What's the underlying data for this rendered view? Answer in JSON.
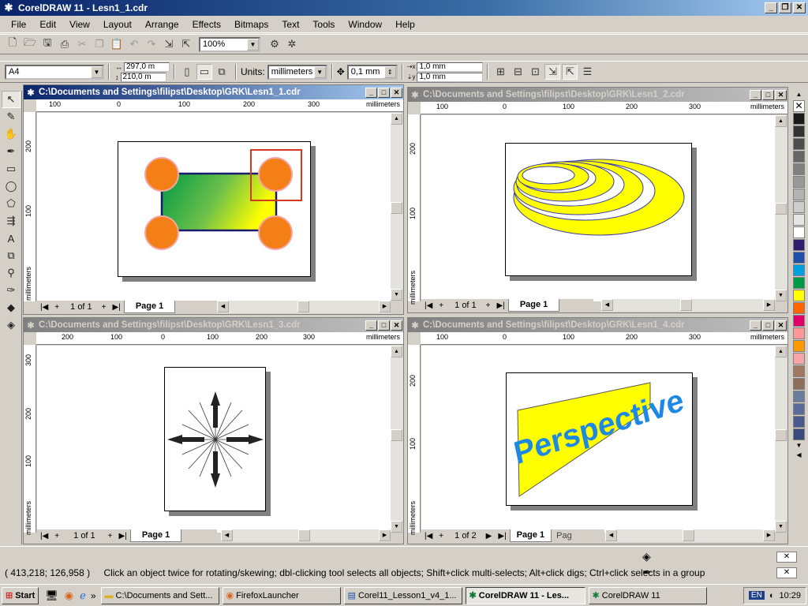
{
  "app": {
    "title": "CorelDRAW 11 - Lesn1_1.cdr"
  },
  "menu": [
    "File",
    "Edit",
    "View",
    "Layout",
    "Arrange",
    "Effects",
    "Bitmaps",
    "Text",
    "Tools",
    "Window",
    "Help"
  ],
  "standard_toolbar": {
    "zoom_value": "100%"
  },
  "property_bar": {
    "paper_size": "A4",
    "width": "297,0 m",
    "height": "210,0 m",
    "units_label": "Units:",
    "units_value": "millimeters",
    "nudge": "0,1 mm",
    "dup_x": "1,0 mm",
    "dup_y": "1,0 mm"
  },
  "windows": [
    {
      "title": "C:\\Documents and Settings\\filipst\\Desktop\\GRK\\Lesn1_1.cdr",
      "active": true,
      "ruler_unit": "millimeters",
      "h_ticks": [
        "100",
        "0",
        "100",
        "200",
        "300"
      ],
      "v_ticks": [
        "200",
        "100"
      ],
      "v_unit": "millimeters",
      "page_count": "1 of 1",
      "page_tab": "Page 1"
    },
    {
      "title": "C:\\Documents and Settings\\filipst\\Desktop\\GRK\\Lesn1_2.cdr",
      "active": false,
      "ruler_unit": "millimeters",
      "h_ticks": [
        "100",
        "0",
        "100",
        "200",
        "300"
      ],
      "v_ticks": [
        "200",
        "100"
      ],
      "v_unit": "millimeters",
      "page_count": "1 of 1",
      "page_tab": "Page 1"
    },
    {
      "title": "C:\\Documents and Settings\\filipst\\Desktop\\GRK\\Lesn1_3.cdr",
      "active": false,
      "ruler_unit": "millimeters",
      "h_ticks": [
        "200",
        "100",
        "0",
        "100",
        "200",
        "300"
      ],
      "v_ticks": [
        "300",
        "200",
        "100"
      ],
      "v_unit": "millimeters",
      "page_count": "1 of 1",
      "page_tab": "Page 1"
    },
    {
      "title": "C:\\Documents and Settings\\filipst\\Desktop\\GRK\\Lesn1_4.cdr",
      "active": false,
      "ruler_unit": "millimeters",
      "h_ticks": [
        "100",
        "0",
        "100",
        "200",
        "300"
      ],
      "v_ticks": [
        "200",
        "100"
      ],
      "v_unit": "millimeters",
      "page_count": "1 of 2",
      "page_tab": "Page 1",
      "page_tab2": "Pag",
      "art_text": "Perspective"
    }
  ],
  "palette_colors": [
    "#1a1a1a",
    "#333333",
    "#4d4d4d",
    "#666666",
    "#808080",
    "#999999",
    "#b3b3b3",
    "#cccccc",
    "#e6e6e6",
    "#ffffff",
    "#2e1f6e",
    "#1f4fa8",
    "#00a0e0",
    "#009a44",
    "#ffff00",
    "#ff6600",
    "#e0006a",
    "#ff9999",
    "#ff9900",
    "#f4a6a6",
    "#a07860",
    "#8c6e5a",
    "#6b7c9c",
    "#5a6b9c",
    "#4b5a8c",
    "#3a4a7c"
  ],
  "status": {
    "coords": "( 413,218; 126,958 )",
    "hint": "Click an object twice for rotating/skewing; dbl-clicking tool selects all objects; Shift+click multi-selects; Alt+click digs; Ctrl+click selects in a group"
  },
  "taskbar": {
    "start": "Start",
    "items": [
      "C:\\Documents and Sett...",
      "FirefoxLauncher",
      "Corel11_Lesson1_v4_1...",
      "CorelDRAW 11 - Les...",
      "CorelDRAW 11"
    ],
    "lang": "EN",
    "clock": "10:29"
  }
}
